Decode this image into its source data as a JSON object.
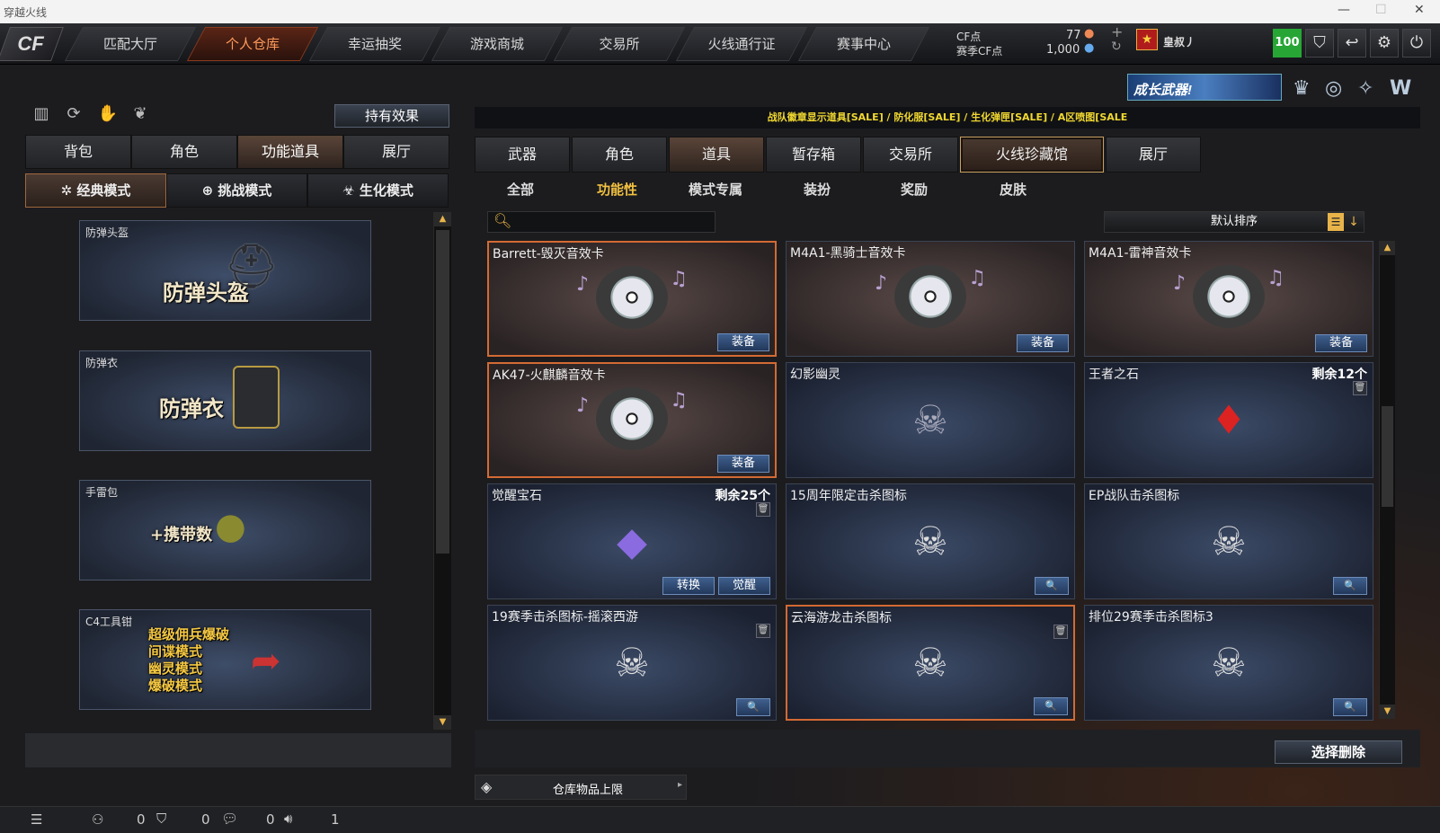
{
  "window": {
    "title": "穿越火线",
    "controls": [
      "—",
      "☐",
      "✕"
    ]
  },
  "nav": {
    "logo": "CF",
    "tabs": [
      "匹配大厅",
      "个人仓库",
      "幸运抽奖",
      "游戏商城",
      "交易所",
      "火线通行证",
      "赛事中心"
    ],
    "active": 1
  },
  "points": {
    "cf_label": "CF点",
    "season_label": "赛季CF点",
    "cf_value": "77",
    "season_value": "1,000"
  },
  "user": {
    "name": "皇叔丿",
    "level": "100"
  },
  "promo": {
    "text": "成长武器!"
  },
  "left": {
    "effect_button": "持有效果",
    "tabs": [
      "背包",
      "角色",
      "功能道具",
      "展厅"
    ],
    "active_tab": 2,
    "modes": [
      "经典模式",
      "挑战模式",
      "生化模式"
    ],
    "active_mode": 0,
    "cards": [
      {
        "label": "防弹头盔",
        "big": "防弹头盔"
      },
      {
        "label": "防弹衣",
        "big": "防弹衣"
      },
      {
        "label": "手雷包",
        "big": "+携带数"
      },
      {
        "label": "C4工具钳",
        "big": "超级佣兵爆破\n间谍模式\n幽灵模式\n爆破模式"
      }
    ]
  },
  "right": {
    "banner": "战队徽章显示道具[SALE]  /  防化服[SALE]  /  生化弹匣[SALE]  /  A区喷图[SALE",
    "tabs": [
      "武器",
      "角色",
      "道具",
      "暂存箱",
      "交易所",
      "火线珍藏馆",
      "展厅"
    ],
    "active_tab": 2,
    "gold_tab": 5,
    "subtabs": [
      "全部",
      "功能性",
      "模式专属",
      "装扮",
      "奖励",
      "皮肤"
    ],
    "active_sub": 1,
    "search_placeholder": "",
    "sort_label": "默认排序",
    "items": [
      {
        "name": "Barrett-毁灭音效卡",
        "type": "sound",
        "buttons": [
          "装备"
        ],
        "hl": true
      },
      {
        "name": "M4A1-黑骑士音效卡",
        "type": "sound",
        "buttons": [
          "装备"
        ]
      },
      {
        "name": "M4A1-雷神音效卡",
        "type": "sound",
        "buttons": [
          "装备"
        ]
      },
      {
        "name": "AK47-火麒麟音效卡",
        "type": "sound",
        "buttons": [
          "装备"
        ],
        "hl": true
      },
      {
        "name": "幻影幽灵",
        "type": "ghost",
        "buttons": []
      },
      {
        "name": "王者之石",
        "type": "ruby",
        "count": "剩余12个",
        "trash": true,
        "buttons": []
      },
      {
        "name": "觉醒宝石",
        "type": "gem",
        "count": "剩余25个",
        "trash": true,
        "buttons": [
          "转换",
          "觉醒"
        ]
      },
      {
        "name": "15周年限定击杀图标",
        "type": "skull",
        "buttons": [
          "🔍"
        ]
      },
      {
        "name": "EP战队击杀图标",
        "type": "skull",
        "buttons": [
          "🔍"
        ]
      },
      {
        "name": "19赛季击杀图标-摇滚西游",
        "type": "skull",
        "trash": true,
        "buttons": [
          "🔍"
        ]
      },
      {
        "name": "云海游龙击杀图标",
        "type": "skull",
        "trash": true,
        "buttons": [
          "🔍"
        ],
        "hl": true
      },
      {
        "name": "排位29赛季击杀图标3",
        "type": "skull",
        "buttons": [
          "🔍"
        ]
      }
    ],
    "select_delete": "选择删除",
    "storage_limit": "仓库物品上限"
  },
  "bottom": {
    "values": [
      "0",
      "0",
      "0",
      "1"
    ]
  }
}
